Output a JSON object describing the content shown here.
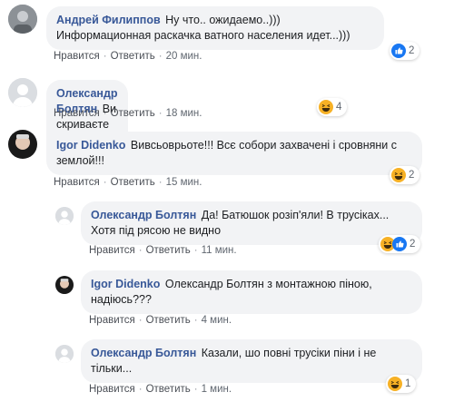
{
  "actions": {
    "like": "Нравится",
    "reply": "Ответить",
    "separator": "·"
  },
  "comments": [
    {
      "author": "Андрей Филиппов",
      "text": "Ну что.. ожидаемо..))) Информационная раскачка ватного населения идет...)))",
      "time": "20 мин.",
      "reactions": {
        "icons": [
          "like-icon"
        ],
        "count": "2"
      }
    },
    {
      "author": "Олександр Болтян",
      "text": "Ви скриваєте од людей правду!",
      "time": "18 мин.",
      "reactions": {
        "icons": [
          "haha-icon"
        ],
        "count": "4"
      }
    },
    {
      "author": "Igor Didenko",
      "text": "Вивсьоврьоте!!! Всє собори захваченi і сровняни с землой!!!",
      "time": "15 мин.",
      "reactions": {
        "icons": [
          "haha-icon"
        ],
        "count": "2"
      }
    },
    {
      "author": "Олександр Болтян",
      "text": "Да! Батюшок розiп'яли! В трусiках... Хотя пiд рясою не видно",
      "time": "11 мин.",
      "reactions": {
        "icons": [
          "haha-icon",
          "like-icon"
        ],
        "count": "2"
      }
    },
    {
      "author": "Igor Didenko",
      "text": "Олександр Болтян з монтажною пiною, надiюсь???",
      "time": "4 мин.",
      "reactions": null
    },
    {
      "author": "Олександр Болтян",
      "text": "Казали, шо повнi трусiки пiни i не тiльки...",
      "time": "1 мин.",
      "reactions": {
        "icons": [
          "haha-icon"
        ],
        "count": "1"
      }
    }
  ],
  "colors": {
    "author": "#385898",
    "bubble": "#f2f3f5",
    "like_blue": "#1877f2",
    "haha_yellow": "#f7b125"
  }
}
